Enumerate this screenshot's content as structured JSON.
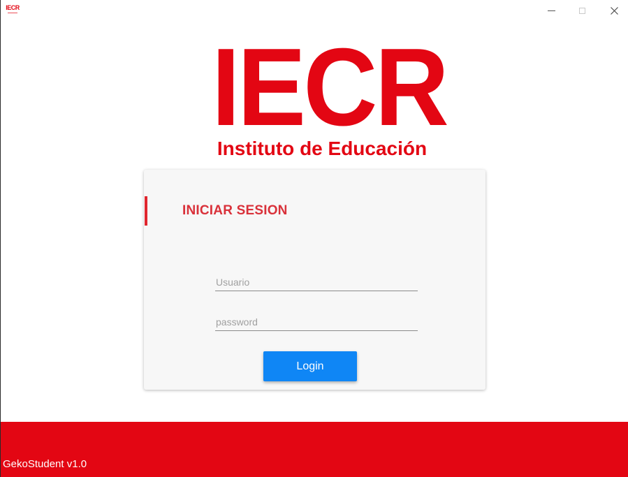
{
  "window": {
    "icon_text": "IECR",
    "controls": {
      "minimize": "minimize",
      "maximize": "maximize",
      "close": "close"
    }
  },
  "logo": {
    "word": "IECR",
    "subtitle": "Instituto de Educación"
  },
  "login": {
    "title": "INICIAR SESION",
    "username_placeholder": "Usuario",
    "username_value": "",
    "password_placeholder": "password",
    "password_value": "",
    "button_label": "Login"
  },
  "footer": {
    "version": "GekoStudent v1.0"
  },
  "colors": {
    "brand_red": "#e30613",
    "title_red": "#d9313a",
    "button_blue": "#0f86f5",
    "card_background": "#f7f7f7"
  },
  "icons": [
    "app-logo-icon",
    "minimize-icon",
    "maximize-icon",
    "close-icon"
  ]
}
